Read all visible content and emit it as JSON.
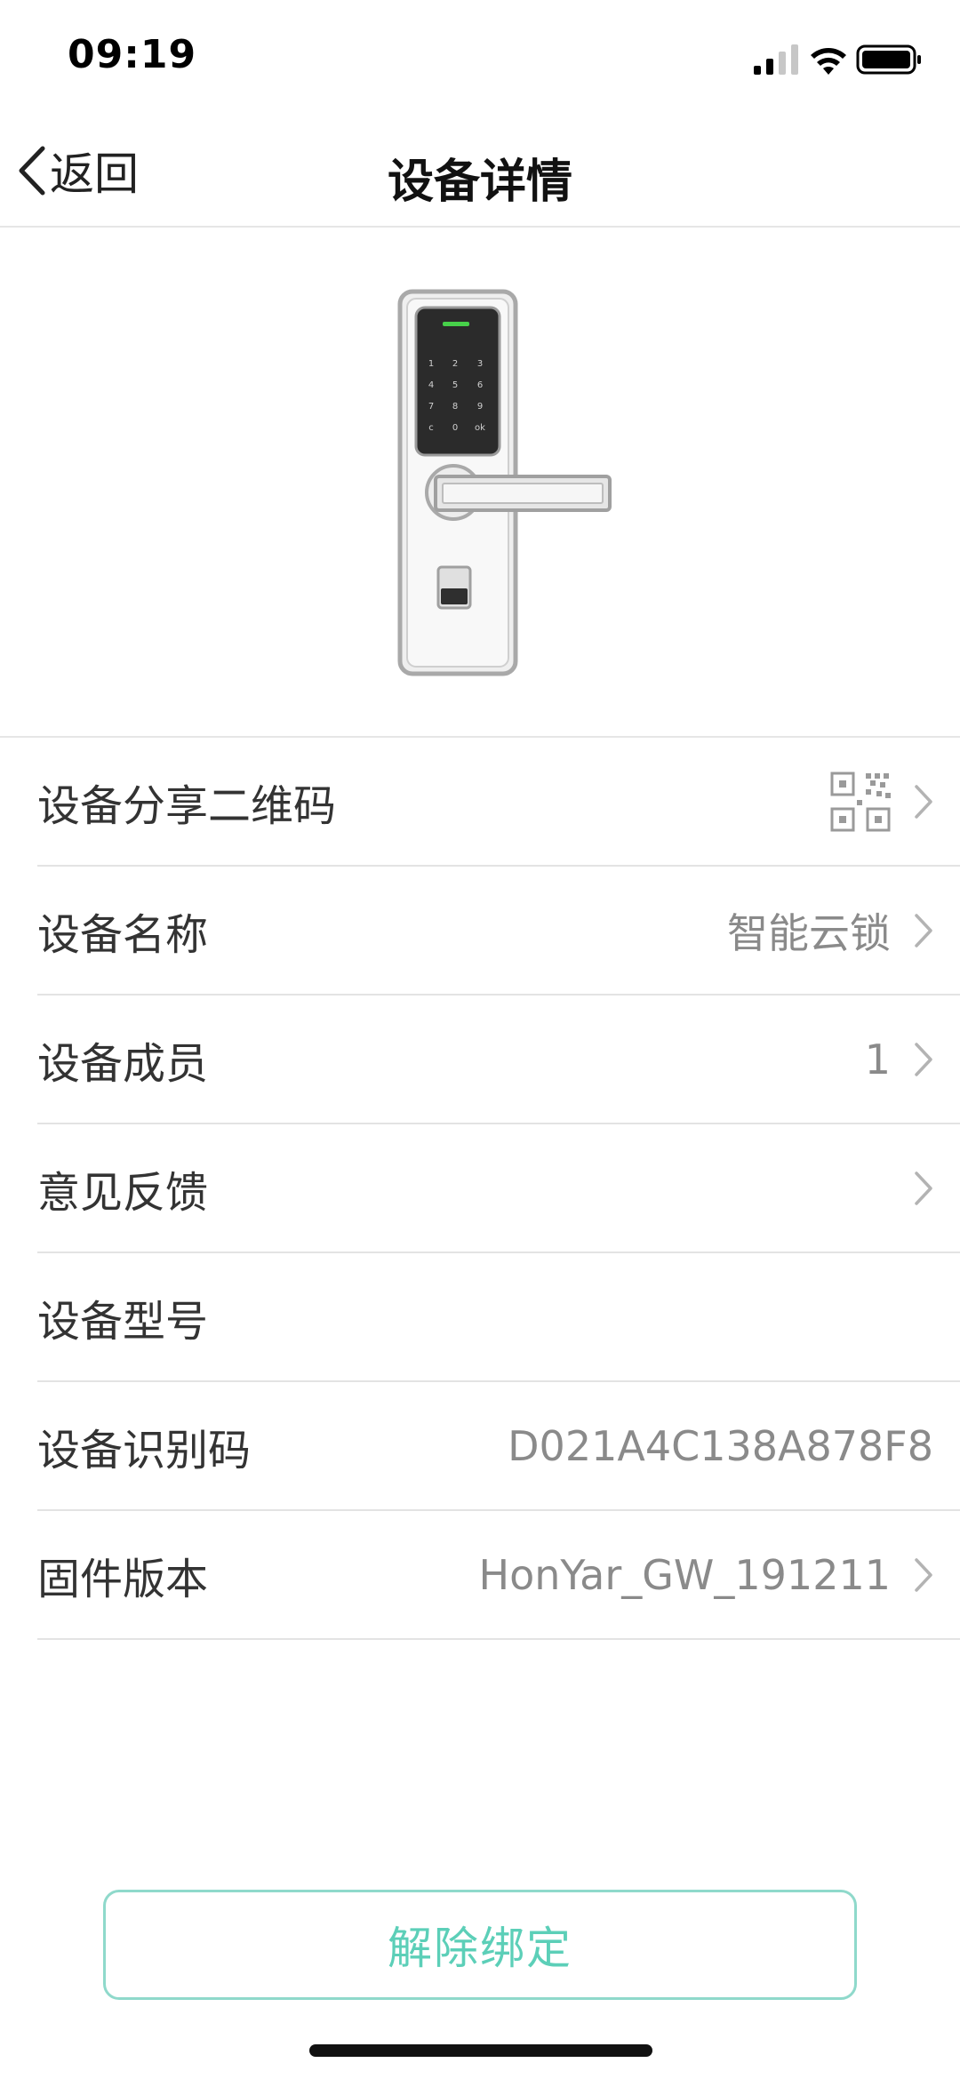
{
  "status_bar": {
    "time": "09:19"
  },
  "nav": {
    "back_label": "返回",
    "title": "设备详情"
  },
  "device": {
    "image": "smart-door-lock"
  },
  "rows": [
    {
      "label": "设备分享二维码",
      "value": "",
      "icon": "qr-code-icon",
      "chevron": true
    },
    {
      "label": "设备名称",
      "value": "智能云锁",
      "chevron": true
    },
    {
      "label": "设备成员",
      "value": "1",
      "chevron": true
    },
    {
      "label": "意见反馈",
      "value": "",
      "chevron": true
    },
    {
      "label": "设备型号",
      "value": "",
      "chevron": false
    },
    {
      "label": "设备识别码",
      "value": "D021A4C138A878F8",
      "chevron": false
    },
    {
      "label": "固件版本",
      "value": "HonYar_GW_191211",
      "chevron": true
    }
  ],
  "unbind_button": {
    "label": "解除绑定"
  },
  "colors": {
    "accent": "#5ccfb8",
    "accent_border": "#8fd9cb",
    "value_text": "#8a8a8a",
    "divider": "#e3e3e3"
  }
}
